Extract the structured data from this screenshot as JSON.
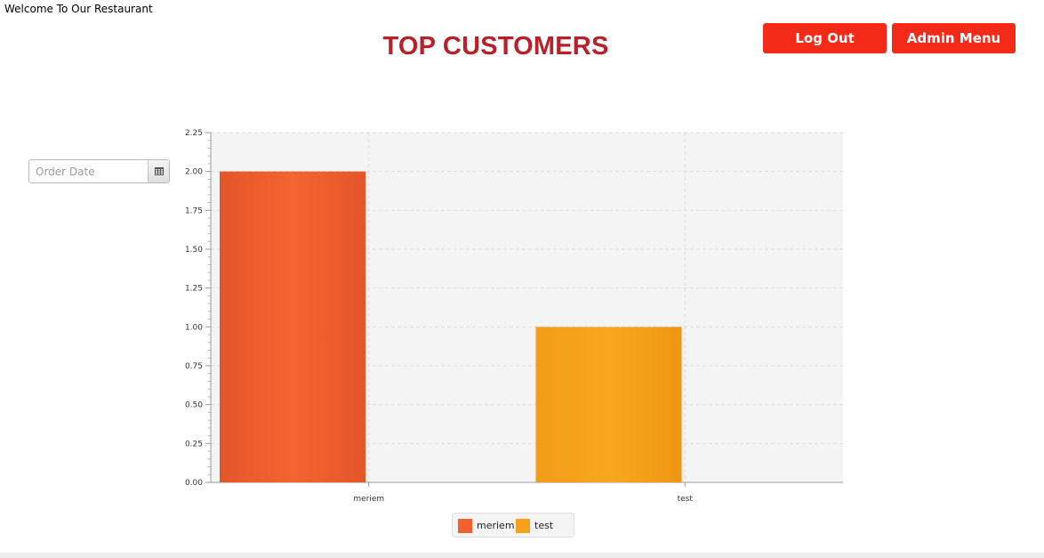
{
  "header": {
    "welcome": "Welcome To Our Restaurant",
    "title": "TOP CUSTOMERS"
  },
  "buttons": {
    "logout": "Log Out",
    "admin_menu": "Admin Menu"
  },
  "filter": {
    "date_placeholder": "Order Date",
    "date_value": "",
    "calendar_icon": "calendar-icon"
  },
  "colors": {
    "title": "#b8202a",
    "button": "#f42a18",
    "series_meriem": "#f26130",
    "series_test": "#f7a01e"
  },
  "chart_data": {
    "type": "bar",
    "categories": [
      "meriem",
      "test"
    ],
    "series": [
      {
        "name": "meriem",
        "category": "meriem",
        "value": 2.0,
        "color": "#f26130"
      },
      {
        "name": "test",
        "category": "test",
        "value": 1.0,
        "color": "#f7a01e"
      }
    ],
    "values": [
      2.0,
      1.0
    ],
    "ylim": [
      0,
      2.25
    ],
    "yticks": [
      "0.00",
      "0.25",
      "0.50",
      "0.75",
      "1.00",
      "1.25",
      "1.50",
      "1.75",
      "2.00",
      "2.25"
    ],
    "grid": true,
    "legend": "bottom-center",
    "title": "",
    "xlabel": "",
    "ylabel": ""
  }
}
